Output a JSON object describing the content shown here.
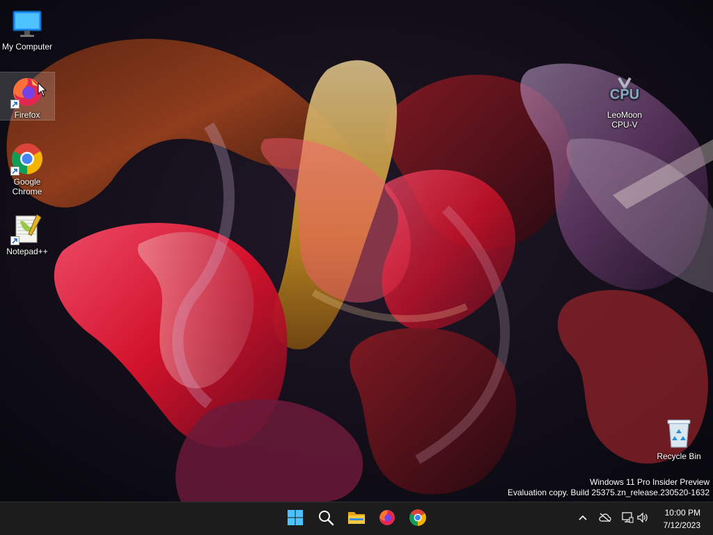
{
  "desktop": {
    "icons": [
      {
        "label": "My Computer"
      },
      {
        "label": "Firefox"
      },
      {
        "label": "Google Chrome"
      },
      {
        "label": "Notepad++"
      },
      {
        "label": "LeoMoon CPU-V",
        "logo_text": "CPU"
      },
      {
        "label": "Recycle Bin"
      }
    ],
    "watermark": {
      "line1": "Windows 11 Pro Insider Preview",
      "line2": "Evaluation copy. Build 25375.zn_release.230520-1632"
    }
  },
  "taskbar": {
    "pinned": [
      {
        "icon": "windows-start-icon"
      },
      {
        "icon": "search-icon"
      },
      {
        "icon": "file-explorer-icon"
      },
      {
        "icon": "firefox-icon"
      },
      {
        "icon": "chrome-icon"
      }
    ],
    "tray": {
      "icons": [
        "chevron-up-icon",
        "onedrive-offline-icon",
        "network-icon",
        "volume-icon"
      ],
      "time": "10:00 PM",
      "date": "7/12/2023"
    }
  },
  "colors": {
    "taskbar_bg": "#1c1c1c",
    "desktop_bg": "#0d0c16",
    "accent": "#0078d4"
  }
}
